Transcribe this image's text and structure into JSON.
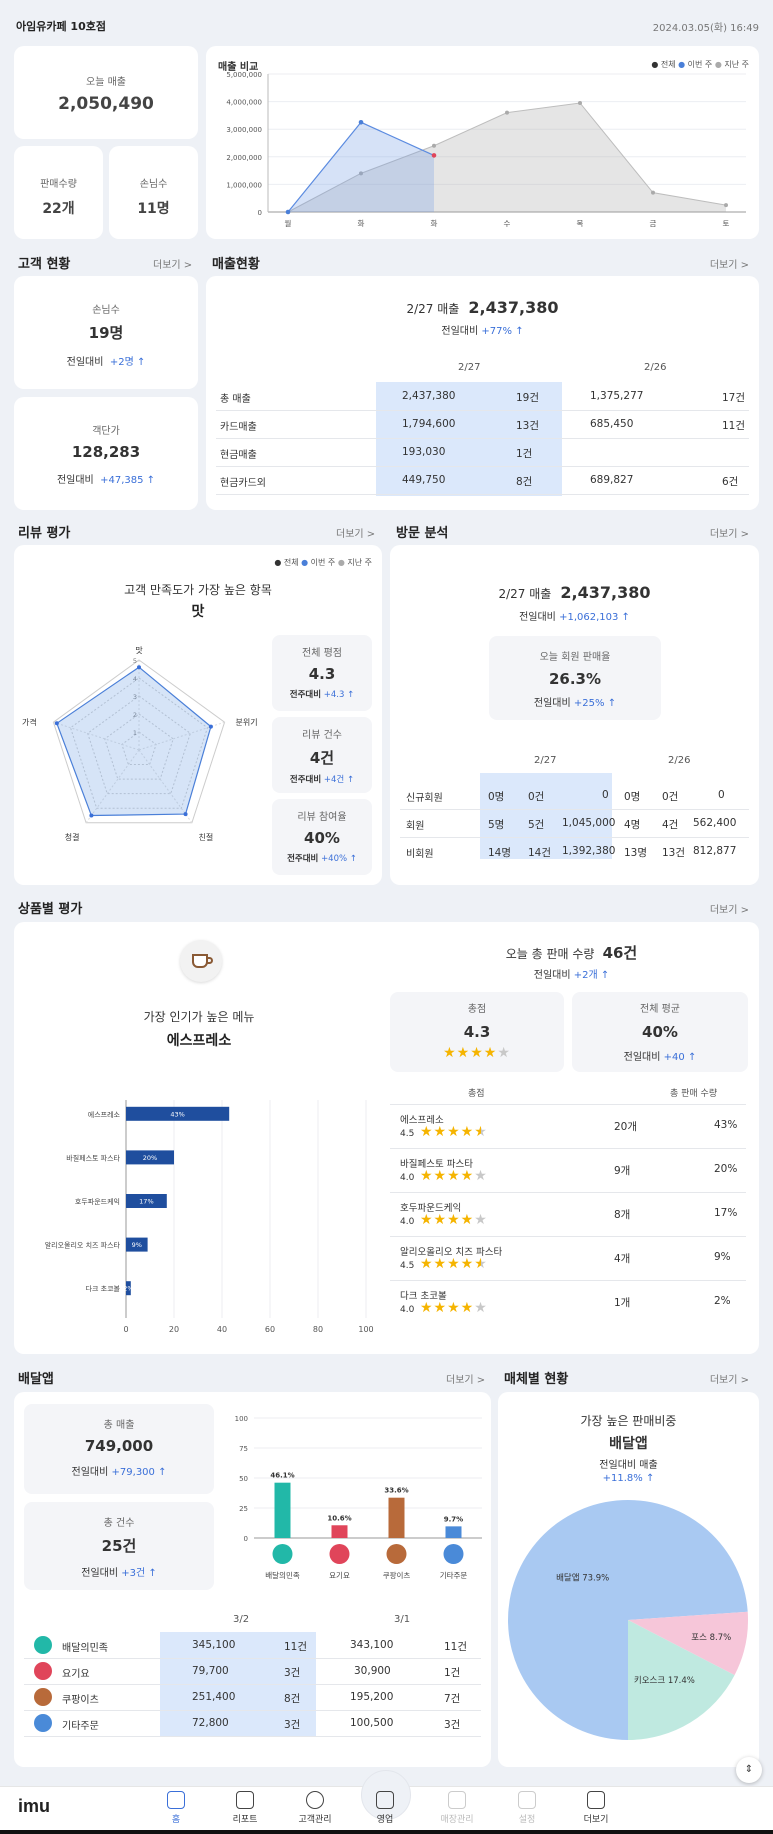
{
  "header": {
    "store": "아임유카페 10호점",
    "datetime": "2024.03.05(화) 16:49"
  },
  "summary": {
    "today_sales_label": "오늘 매출",
    "today_sales": "2,050,490",
    "qty_label": "판매수량",
    "qty": "22개",
    "guests_label": "손님수",
    "guests": "11명"
  },
  "sales_compare": {
    "title": "매출 비교",
    "legend": [
      "전체",
      "이번 주",
      "지난 주"
    ],
    "yticks": [
      "5,000,000",
      "4,000,000",
      "3,000,000",
      "2,000,000",
      "1,000,000",
      "0"
    ],
    "days": [
      "월",
      "화",
      "화",
      "수",
      "목",
      "금",
      "토"
    ]
  },
  "chart_data": [
    {
      "type": "line",
      "title": "매출 비교",
      "categories": [
        "월",
        "화",
        "화",
        "수",
        "목",
        "금",
        "토"
      ],
      "ylim": [
        0,
        5000000
      ],
      "series": [
        {
          "name": "이번 주",
          "values": [
            0,
            3250000,
            2050000,
            null,
            null,
            null,
            null
          ]
        },
        {
          "name": "지난 주",
          "values": [
            0,
            1400000,
            2400000,
            3600000,
            3950000,
            700000,
            250000
          ]
        }
      ],
      "legend": "top-right",
      "grid": true
    },
    {
      "type": "bar",
      "title": "",
      "categories": [
        "에스프레소",
        "바질페스토 파스타",
        "호두파운드케익",
        "알리오올리오 치즈 파스타",
        "다크 초코볼"
      ],
      "values": [
        43,
        20,
        17,
        9,
        2
      ],
      "xlim": [
        0,
        100
      ],
      "xticks": [
        "0",
        "20",
        "40",
        "60",
        "80",
        "100"
      ]
    },
    {
      "type": "bar",
      "title": "",
      "categories": [
        "배달의민족",
        "요기요",
        "쿠팡이츠",
        "기타주문"
      ],
      "values": [
        46.1,
        10.6,
        33.6,
        9.7
      ],
      "ylim": [
        0,
        100
      ],
      "yticks": [
        "100",
        "75",
        "50",
        "25",
        "0"
      ]
    },
    {
      "type": "pie",
      "title": "",
      "labels": [
        "배달앱",
        "키오스크",
        "포스"
      ],
      "values": [
        73.9,
        17.4,
        8.7
      ],
      "colors": [
        "#a9c9f2",
        "#bfe9e0",
        "#f6c6d9"
      ]
    }
  ],
  "customer": {
    "title": "고객 현황",
    "more": "더보기 >",
    "guests_label": "손님수",
    "guests": "19명",
    "guests_cmp_label": "전일대비",
    "guests_cmp": "+2명 ↑",
    "avg_label": "객단가",
    "avg": "128,283",
    "avg_cmp_label": "전일대비",
    "avg_cmp": "+47,385 ↑"
  },
  "sales_status": {
    "title": "매출현황",
    "more": "더보기 >",
    "headline_label": "2/27 매출",
    "headline_value": "2,437,380",
    "cmp_label": "전일대비",
    "cmp": "+77% ↑",
    "col1": "2/27",
    "col2": "2/26",
    "rows": [
      {
        "label": "총 매출",
        "a": "2,437,380",
        "b": "19건",
        "c": "1,375,277",
        "d": "17건"
      },
      {
        "label": "카드매출",
        "a": "1,794,600",
        "b": "13건",
        "c": "685,450",
        "d": "11건"
      },
      {
        "label": "현금매출",
        "a": "193,030",
        "b": "1건",
        "c": "",
        "d": ""
      },
      {
        "label": "현금카드외",
        "a": "449,750",
        "b": "8건",
        "c": "689,827",
        "d": "6건"
      }
    ]
  },
  "review": {
    "title": "리뷰 평가",
    "more": "더보기 >",
    "legend": [
      "전체",
      "이번 주",
      "지난 주"
    ],
    "heading": "고객 만족도가 가장 높은 항목",
    "top_item": "맛",
    "axes": [
      "맛",
      "분위기",
      "친절",
      "청결",
      "가격"
    ],
    "axis_ticks": [
      "5",
      "4",
      "3",
      "2",
      "1"
    ],
    "values": [
      4.6,
      4.2,
      4.4,
      4.5,
      4.8
    ],
    "avg_label": "전체 평점",
    "avg": "4.3",
    "avg_cmp_label": "전주대비",
    "avg_cmp": "+4.3 ↑",
    "count_label": "리뷰 건수",
    "count": "4건",
    "count_cmp_label": "전주대비",
    "count_cmp": "+4건 ↑",
    "rate_label": "리뷰 참여율",
    "rate": "40%",
    "rate_cmp_label": "전주대비",
    "rate_cmp": "+40% ↑"
  },
  "visit": {
    "title": "방문 분석",
    "more": "더보기 >",
    "headline_label": "2/27 매출",
    "headline_value": "2,437,380",
    "cmp_label": "전일대비",
    "cmp": "+1,062,103 ↑",
    "member_label": "오늘 회원 판매율",
    "member_rate": "26.3%",
    "member_cmp_label": "전일대비",
    "member_cmp": "+25% ↑",
    "col1": "2/27",
    "col2": "2/26",
    "rows": [
      {
        "label": "신규회원",
        "a": "0명",
        "b": "0건",
        "c": "0",
        "d": "0명",
        "e": "0건",
        "f": "0"
      },
      {
        "label": "회원",
        "a": "5명",
        "b": "5건",
        "c": "1,045,000",
        "d": "4명",
        "e": "4건",
        "f": "562,400"
      },
      {
        "label": "비회원",
        "a": "14명",
        "b": "14건",
        "c": "1,392,380",
        "d": "13명",
        "e": "13건",
        "f": "812,877"
      }
    ]
  },
  "product": {
    "title": "상품별 평가",
    "more": "더보기 >",
    "popular_label": "가장 인기가 높은 메뉴",
    "popular": "에스프레소",
    "total_label": "오늘 총 판매 수량",
    "total": "46건",
    "total_cmp_label": "전일대비",
    "total_cmp": "+2개 ↑",
    "score_label": "총점",
    "score": "4.3",
    "avg_label": "전체 평균",
    "avg": "40%",
    "avg_cmp_label": "전일대비",
    "avg_cmp": "+40 ↑",
    "table_h1": "총점",
    "table_h2": "총 판매 수량",
    "bar_labels": [
      "43%",
      "20%",
      "17%",
      "9%",
      "2%"
    ],
    "items": [
      {
        "name": "에스프레소",
        "score": "4.5",
        "stars": 4.5,
        "qty": "20개",
        "pct": "43%"
      },
      {
        "name": "바질페스토 파스타",
        "score": "4.0",
        "stars": 4,
        "qty": "9개",
        "pct": "20%"
      },
      {
        "name": "호두파운드케익",
        "score": "4.0",
        "stars": 4,
        "qty": "8개",
        "pct": "17%"
      },
      {
        "name": "알리오올리오 치즈 파스타",
        "score": "4.5",
        "stars": 4.5,
        "qty": "4개",
        "pct": "9%"
      },
      {
        "name": "다크 초코볼",
        "score": "4.0",
        "stars": 4,
        "qty": "1개",
        "pct": "2%"
      }
    ]
  },
  "delivery": {
    "title": "배달앱",
    "more": "더보기 >",
    "sales_label": "총 매출",
    "sales": "749,000",
    "sales_cmp_label": "전일대비",
    "sales_cmp": "+79,300 ↑",
    "count_label": "총 건수",
    "count": "25건",
    "count_cmp_label": "전일대비",
    "count_cmp": "+3건 ↑",
    "bar_labels": [
      "46.1%",
      "10.6%",
      "33.6%",
      "9.7%"
    ],
    "app_names": [
      "배달의민족",
      "요기요",
      "쿠팡이츠",
      "기타주문"
    ],
    "colors": [
      "#22b8a8",
      "#e0455a",
      "#b86a3a",
      "#4a8ad8"
    ],
    "col1": "3/2",
    "col2": "3/1",
    "rows": [
      {
        "label": "배달의민족",
        "a": "345,100",
        "b": "11건",
        "c": "343,100",
        "d": "11건"
      },
      {
        "label": "요기요",
        "a": "79,700",
        "b": "3건",
        "c": "30,900",
        "d": "1건"
      },
      {
        "label": "쿠팡이츠",
        "a": "251,400",
        "b": "8건",
        "c": "195,200",
        "d": "7건"
      },
      {
        "label": "기타주문",
        "a": "72,800",
        "b": "3건",
        "c": "100,500",
        "d": "3건"
      }
    ]
  },
  "channel": {
    "title": "매체별 현황",
    "more": "더보기 >",
    "top_label": "가장 높은 판매비중",
    "top": "배달앱",
    "cmp_label": "전일대비 매출",
    "cmp": "+11.8% ↑",
    "slice_labels": [
      "배달앱 73.9%",
      "키오스크 17.4%",
      "포스 8.7%"
    ]
  },
  "nav": {
    "logo": "imu",
    "items": [
      "홈",
      "리포트",
      "고객관리",
      "영업",
      "매장관리",
      "설정",
      "더보기"
    ]
  }
}
